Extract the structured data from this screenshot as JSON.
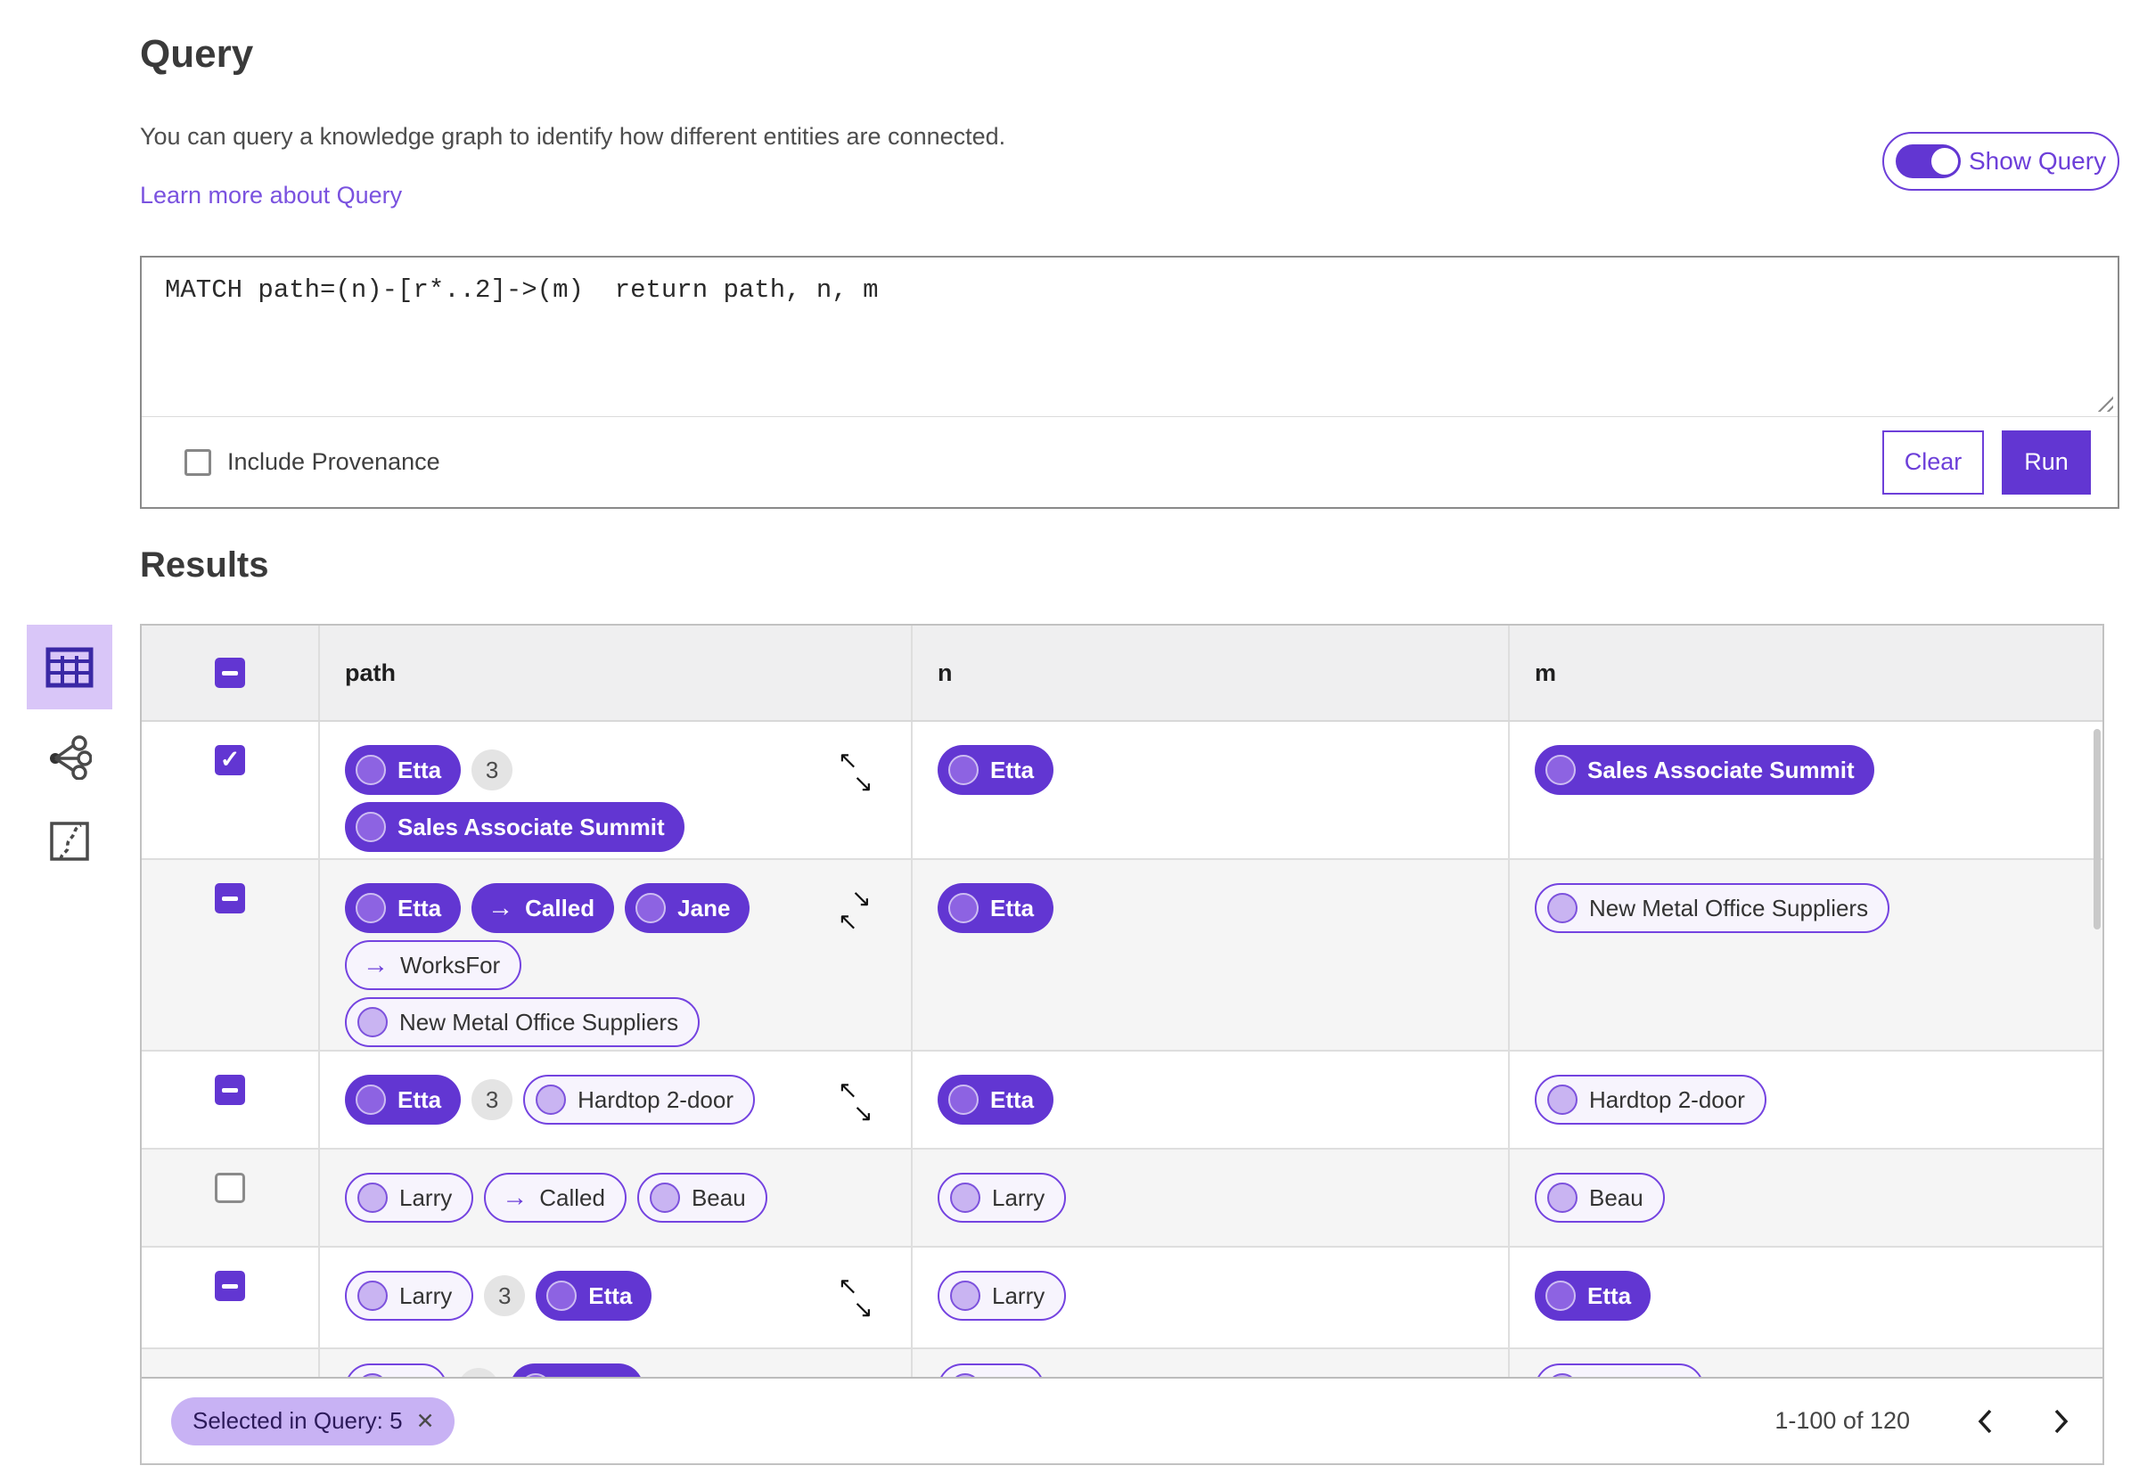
{
  "header": {
    "title": "Query",
    "description": "You can query a knowledge graph to identify how different entities are connected.",
    "learn_more": "Learn more about Query",
    "show_query_label": "Show Query",
    "show_query_state": "on"
  },
  "editor": {
    "query_text": "MATCH path=(n)-[r*..2]->(m)  return path, n, m",
    "include_provenance_label": "Include Provenance",
    "include_provenance_checked": false,
    "clear_label": "Clear",
    "run_label": "Run"
  },
  "view_switcher": {
    "items": [
      "table-view",
      "graph-view",
      "map-view"
    ],
    "selected": "table-view"
  },
  "results": {
    "title": "Results",
    "columns": [
      "path",
      "n",
      "m"
    ],
    "header_checkbox": "indeterminate",
    "rows": [
      {
        "checkbox": "checked",
        "expand": "out",
        "path_lines": [
          [
            {
              "kind": "node",
              "label": "Etta",
              "variant": "filled"
            },
            {
              "kind": "count",
              "label": "3"
            }
          ],
          [
            {
              "kind": "node",
              "label": "Sales Associate Summit",
              "variant": "filled"
            }
          ]
        ],
        "n": {
          "kind": "node",
          "label": "Etta",
          "variant": "filled"
        },
        "m": {
          "kind": "node",
          "label": "Sales Associate Summit",
          "variant": "filled"
        }
      },
      {
        "checkbox": "indeterminate",
        "expand": "in",
        "path_lines": [
          [
            {
              "kind": "node",
              "label": "Etta",
              "variant": "filled"
            },
            {
              "kind": "rel",
              "label": "Called",
              "variant": "filled"
            },
            {
              "kind": "node",
              "label": "Jane",
              "variant": "filled"
            }
          ],
          [
            {
              "kind": "rel",
              "label": "WorksFor",
              "variant": "outlined"
            }
          ],
          [
            {
              "kind": "node",
              "label": "New Metal Office Suppliers",
              "variant": "outlined"
            }
          ]
        ],
        "n": {
          "kind": "node",
          "label": "Etta",
          "variant": "filled"
        },
        "m": {
          "kind": "node",
          "label": "New Metal Office Suppliers",
          "variant": "outlined"
        }
      },
      {
        "checkbox": "indeterminate",
        "expand": "out",
        "path_lines": [
          [
            {
              "kind": "node",
              "label": "Etta",
              "variant": "filled"
            },
            {
              "kind": "count",
              "label": "3"
            },
            {
              "kind": "node",
              "label": "Hardtop 2-door",
              "variant": "outlined"
            }
          ]
        ],
        "n": {
          "kind": "node",
          "label": "Etta",
          "variant": "filled"
        },
        "m": {
          "kind": "node",
          "label": "Hardtop 2-door",
          "variant": "outlined"
        }
      },
      {
        "checkbox": "unchecked",
        "expand": "none",
        "path_lines": [
          [
            {
              "kind": "node",
              "label": "Larry",
              "variant": "outlined"
            },
            {
              "kind": "rel",
              "label": "Called",
              "variant": "outlined"
            },
            {
              "kind": "node",
              "label": "Beau",
              "variant": "outlined"
            }
          ]
        ],
        "n": {
          "kind": "node",
          "label": "Larry",
          "variant": "outlined"
        },
        "m": {
          "kind": "node",
          "label": "Beau",
          "variant": "outlined"
        }
      },
      {
        "checkbox": "indeterminate",
        "expand": "out",
        "path_lines": [
          [
            {
              "kind": "node",
              "label": "Larry",
              "variant": "outlined"
            },
            {
              "kind": "count",
              "label": "3"
            },
            {
              "kind": "node",
              "label": "Etta",
              "variant": "filled"
            }
          ]
        ],
        "n": {
          "kind": "node",
          "label": "Larry",
          "variant": "outlined"
        },
        "m": {
          "kind": "node",
          "label": "Etta",
          "variant": "filled"
        }
      },
      {
        "checkbox": "none",
        "expand": "none",
        "partial": true,
        "path_lines": [
          [
            {
              "kind": "node",
              "label": "",
              "variant": "outlined",
              "width": 115
            },
            {
              "kind": "count",
              "label": ""
            },
            {
              "kind": "node",
              "label": "",
              "variant": "filled",
              "width": 150
            }
          ]
        ],
        "n": {
          "kind": "node",
          "label": "",
          "variant": "outlined",
          "width": 120
        },
        "m": {
          "kind": "node",
          "label": "",
          "variant": "outlined",
          "width": 190
        }
      }
    ],
    "footer": {
      "selected_chip": "Selected in Query: 5",
      "range": "1-100 of 120"
    }
  },
  "colors": {
    "accent": "#6236d2",
    "accent_light": "#d9c6f8",
    "pill_outlined_bg": "#f7f4fd",
    "pill_outlined_border": "#7443e0",
    "chip_bg": "#c8b2f4",
    "link": "#7a52df",
    "row_alt_bg": "#f5f5f5",
    "header_bg": "#efeff0"
  }
}
